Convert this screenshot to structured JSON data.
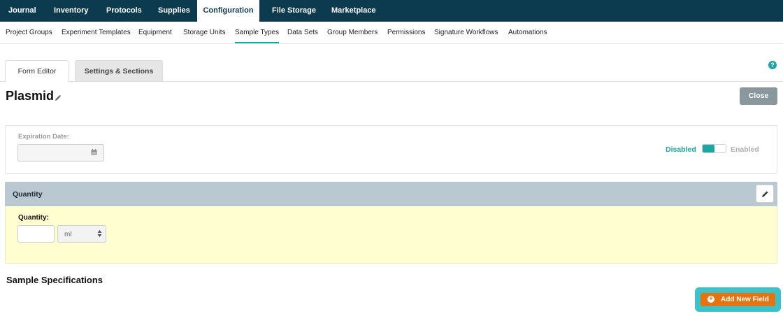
{
  "topnav": {
    "items": [
      "Journal",
      "Inventory",
      "Protocols",
      "Supplies",
      "Configuration",
      "File Storage",
      "Marketplace"
    ],
    "active": "Configuration",
    "bg_color": "#0c3a4f"
  },
  "subnav": {
    "items": [
      "Project Groups",
      "Experiment Templates",
      "Equipment",
      "Storage Units",
      "Sample Types",
      "Data Sets",
      "Group Members",
      "Permissions",
      "Signature Workflows",
      "Automations"
    ],
    "active": "Sample Types",
    "accent_color": "#1aa7a3"
  },
  "tabs": {
    "form_editor": "Form Editor",
    "settings_sections": "Settings & Sections",
    "active": "Form Editor"
  },
  "help": {
    "icon": "help-circle-icon",
    "glyph": "?"
  },
  "page": {
    "title": "Plasmid",
    "close_label": "Close"
  },
  "expiration": {
    "label": "Expiration Date:",
    "value": "",
    "disabled_label": "Disabled",
    "enabled_label": "Enabled",
    "toggle_state": "Disabled"
  },
  "quantity": {
    "header": "Quantity",
    "label": "Quantity:",
    "value": "",
    "unit": "ml",
    "body_color": "#fefed0"
  },
  "sample_specifications": {
    "title": "Sample Specifications"
  },
  "add_field": {
    "label": "Add New Field",
    "plus_glyph": "+",
    "button_color": "#e8730e",
    "highlight_color": "#3cc2c9"
  }
}
